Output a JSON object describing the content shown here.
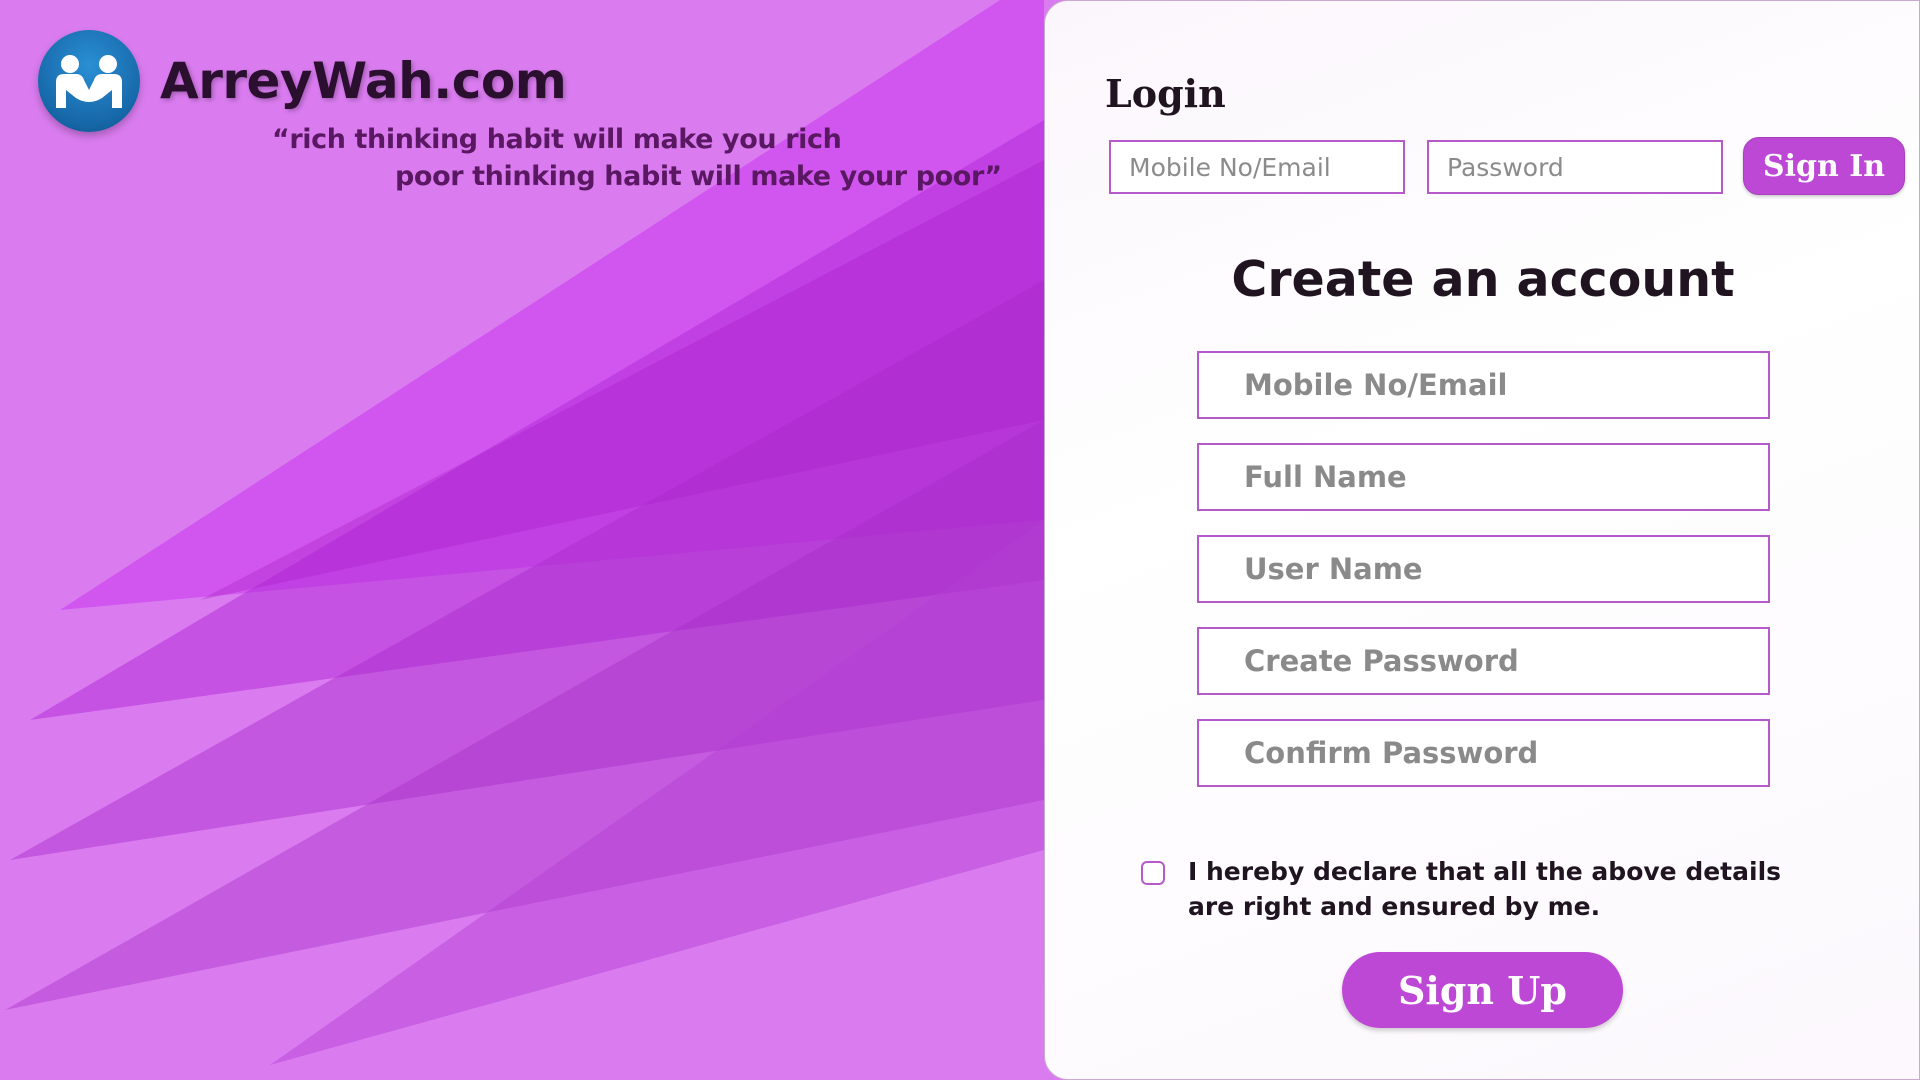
{
  "brand": {
    "name": "ArreyWah.com",
    "quote_line1": "“rich thinking habit will make you rich",
    "quote_line2": "poor thinking habit will make your poor”"
  },
  "login": {
    "title": "Login",
    "username_placeholder": "Mobile No/Email",
    "password_placeholder": "Password",
    "signin_label": "Sign In"
  },
  "register": {
    "title": "Create an account",
    "mobile_placeholder": "Mobile No/Email",
    "fullname_placeholder": "Full Name",
    "username_placeholder": "User Name",
    "create_password_placeholder": "Create Password",
    "confirm_password_placeholder": "Confirm Password",
    "declaration": "I hereby declare that all the above details are right and ensured by me.",
    "signup_label": "Sign Up"
  },
  "icons": {
    "logo": "handshake-people-icon"
  },
  "colors": {
    "background": "#da7cf0",
    "accent": "#be48d6",
    "input_border": "#b65acb",
    "logo_blue": "#1667a8"
  }
}
